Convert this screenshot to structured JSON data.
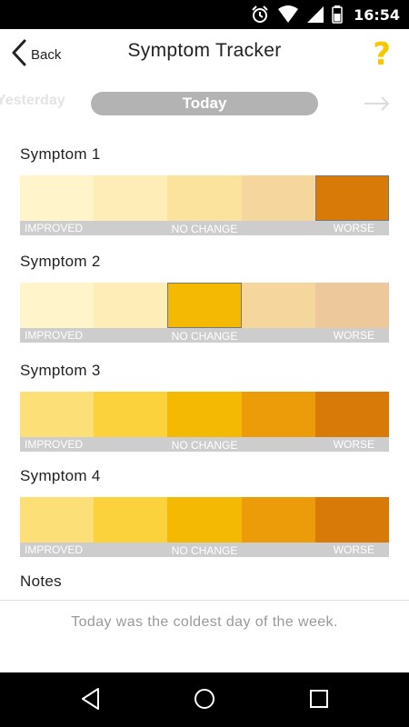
{
  "status_bar": {
    "time": "16:54",
    "icons": [
      "alarm-icon",
      "wifi-icon",
      "signal-icon",
      "battery-icon"
    ]
  },
  "app_bar": {
    "back_label": "Back",
    "title": "Symptom Tracker",
    "help_label": "?",
    "help_color": "#F6C800"
  },
  "day_selector": {
    "previous": "Yesterday",
    "current": "Today",
    "next_icon": "arrow-right-icon"
  },
  "scale_labels": {
    "improved": "IMPROVED",
    "no_change": "NO CHANGE",
    "worse": "WORSE"
  },
  "symptoms": [
    {
      "title": "Symptom 1",
      "selected_index": 4,
      "colors": [
        "#FFF4CA",
        "#FEEDB6",
        "#FBE39E",
        "#F5D69C",
        "#D87A07"
      ]
    },
    {
      "title": "Symptom 2",
      "selected_index": 2,
      "colors": [
        "#FFF4CA",
        "#FEEDB6",
        "#F4B903",
        "#F5D69C",
        "#EDC89A"
      ]
    },
    {
      "title": "Symptom 3",
      "selected_index": null,
      "colors": [
        "#FDDF78",
        "#FBD23C",
        "#F4B903",
        "#EB9C08",
        "#D87A07"
      ]
    },
    {
      "title": "Symptom 4",
      "selected_index": null,
      "colors": [
        "#FDDF78",
        "#FBD23C",
        "#F4B903",
        "#EB9C08",
        "#D87A07"
      ]
    }
  ],
  "notes": {
    "title": "Notes",
    "text": "Today was the coldest day of the week."
  },
  "nav_bar": {
    "icons": [
      "back-nav-icon",
      "home-nav-icon",
      "recents-nav-icon"
    ]
  }
}
